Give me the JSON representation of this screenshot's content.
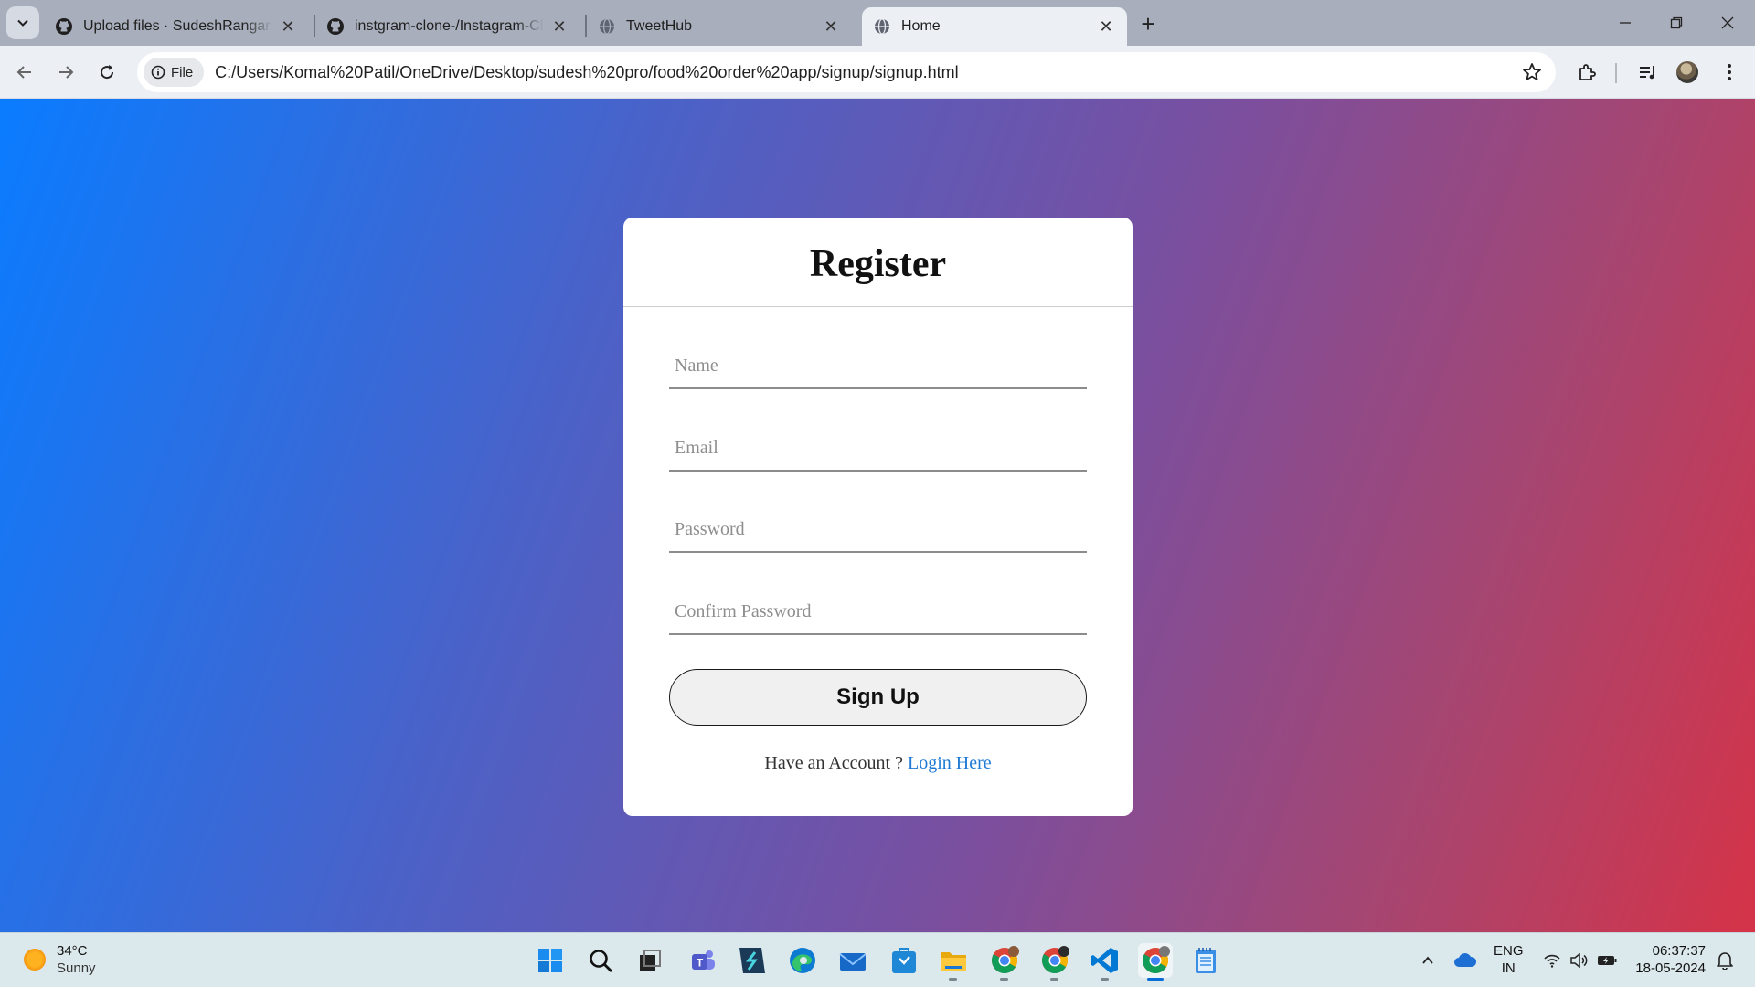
{
  "browser": {
    "tabs": [
      {
        "title": "Upload files · SudeshRangaraoP",
        "icon": "github-icon",
        "active": false
      },
      {
        "title": "instgram-clone-/Instagram-Clo",
        "icon": "github-icon",
        "active": false
      },
      {
        "title": "TweetHub",
        "icon": "globe-icon",
        "active": false
      },
      {
        "title": "Home",
        "icon": "globe-icon",
        "active": true
      }
    ],
    "new_tab_symbol": "+",
    "site_chip_label": "File",
    "url": "C:/Users/Komal%20Patil/OneDrive/Desktop/sudesh%20pro/food%20order%20app/signup/signup.html"
  },
  "page": {
    "title": "Register",
    "fields": {
      "name_placeholder": "Name",
      "email_placeholder": "Email",
      "password_placeholder": "Password",
      "confirm_placeholder": "Confirm Password"
    },
    "signup_label": "Sign Up",
    "login_prompt": "Have an Account ?",
    "login_link": "Login Here",
    "gradient_colors": [
      "#0a7cff",
      "#d53348"
    ]
  },
  "taskbar": {
    "weather_temp": "34°C",
    "weather_desc": "Sunny",
    "lang_top": "ENG",
    "lang_bottom": "IN",
    "time": "06:37:37",
    "date": "18-05-2024"
  }
}
